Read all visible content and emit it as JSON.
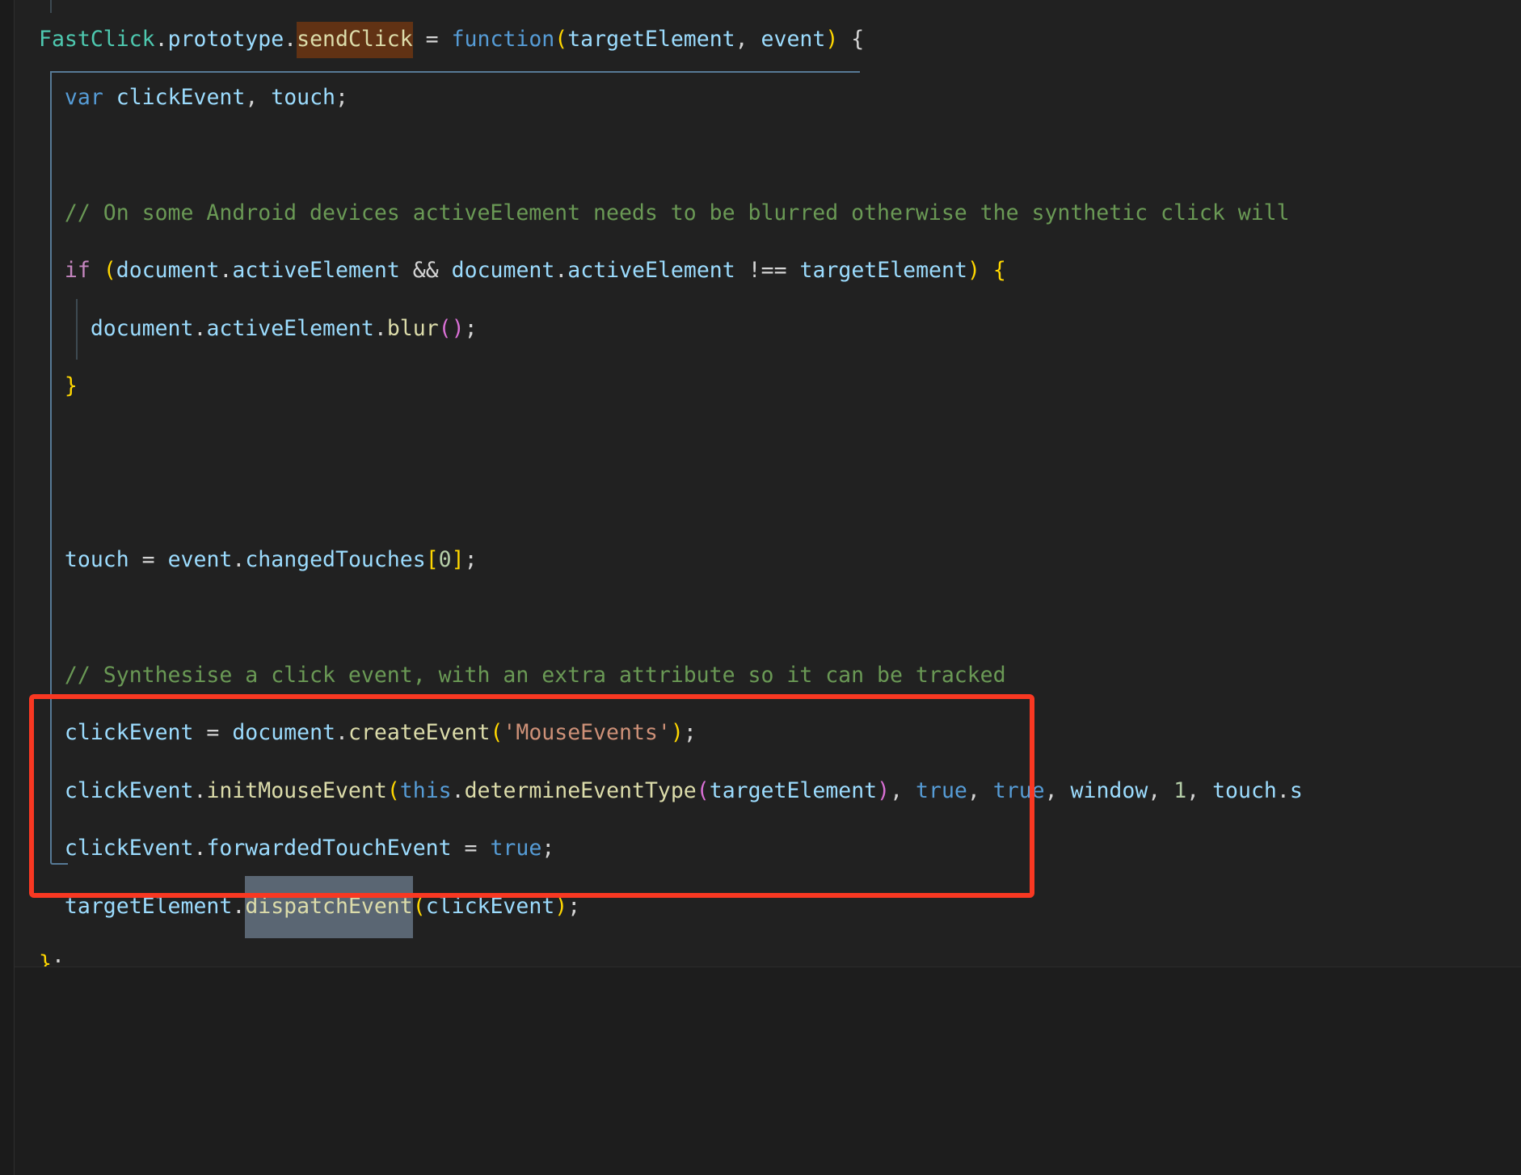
{
  "editor": {
    "language": "javascript",
    "theme": "dark-plus",
    "background_color": "#212121",
    "selection_color": "#5a6673",
    "word_highlight_color": "#613214",
    "annotation_color": "#f93822"
  },
  "annotation": {
    "shape": "rectangle",
    "color": "#f93822",
    "label": "highlighted code region"
  },
  "highlights": {
    "occurrence_highlight": "sendClick",
    "selection": "dispatchEvent"
  },
  "code": {
    "lines": [
      {
        "id": "line-signature",
        "text": "FastClick.prototype.sendClick = function(targetElement, event) {",
        "tokens": [
          {
            "t": "FastClick",
            "c": "t-class"
          },
          {
            "t": ".",
            "c": "t-punct"
          },
          {
            "t": "prototype",
            "c": "t-prop"
          },
          {
            "t": ".",
            "c": "t-punct"
          },
          {
            "t": "sendClick",
            "c": "t-fn",
            "hl": "word"
          },
          {
            "t": " = ",
            "c": "t-punct"
          },
          {
            "t": "function",
            "c": "t-kw"
          },
          {
            "t": "(",
            "c": "t-paren1"
          },
          {
            "t": "targetElement",
            "c": "t-prop"
          },
          {
            "t": ", ",
            "c": "t-punct"
          },
          {
            "t": "event",
            "c": "t-prop"
          },
          {
            "t": ")",
            "c": "t-paren1"
          },
          {
            "t": " ",
            "c": "t-punct"
          },
          {
            "t": "{",
            "c": "t-punct"
          }
        ]
      },
      {
        "id": "line-var",
        "text": "  var clickEvent, touch;",
        "tokens": [
          {
            "t": "  ",
            "c": "t-punct"
          },
          {
            "t": "var",
            "c": "t-kw"
          },
          {
            "t": " ",
            "c": "t-punct"
          },
          {
            "t": "clickEvent",
            "c": "t-prop"
          },
          {
            "t": ", ",
            "c": "t-punct"
          },
          {
            "t": "touch",
            "c": "t-prop"
          },
          {
            "t": ";",
            "c": "t-punct"
          }
        ]
      },
      {
        "id": "line-blank-1",
        "text": "",
        "tokens": []
      },
      {
        "id": "line-comment-android",
        "text": "  // On some Android devices activeElement needs to be blurred otherwise the synthetic click will",
        "tokens": [
          {
            "t": "  ",
            "c": "t-punct"
          },
          {
            "t": "// On some Android devices activeElement needs to be blurred otherwise the synthetic click will",
            "c": "t-cmt"
          }
        ]
      },
      {
        "id": "line-if",
        "text": "  if (document.activeElement && document.activeElement !== targetElement) {",
        "tokens": [
          {
            "t": "  ",
            "c": "t-punct"
          },
          {
            "t": "if",
            "c": "t-ctl"
          },
          {
            "t": " ",
            "c": "t-punct"
          },
          {
            "t": "(",
            "c": "t-paren1"
          },
          {
            "t": "document",
            "c": "t-prop"
          },
          {
            "t": ".",
            "c": "t-punct"
          },
          {
            "t": "activeElement",
            "c": "t-prop"
          },
          {
            "t": " ",
            "c": "t-punct"
          },
          {
            "t": "&&",
            "c": "t-punct"
          },
          {
            "t": " ",
            "c": "t-punct"
          },
          {
            "t": "document",
            "c": "t-prop"
          },
          {
            "t": ".",
            "c": "t-punct"
          },
          {
            "t": "activeElement",
            "c": "t-prop"
          },
          {
            "t": " ",
            "c": "t-punct"
          },
          {
            "t": "!==",
            "c": "t-punct"
          },
          {
            "t": " ",
            "c": "t-punct"
          },
          {
            "t": "targetElement",
            "c": "t-prop"
          },
          {
            "t": ")",
            "c": "t-paren1"
          },
          {
            "t": " ",
            "c": "t-punct"
          },
          {
            "t": "{",
            "c": "t-brace"
          }
        ]
      },
      {
        "id": "line-blur",
        "text": "    document.activeElement.blur();",
        "tokens": [
          {
            "t": "    ",
            "c": "t-punct"
          },
          {
            "t": "document",
            "c": "t-prop"
          },
          {
            "t": ".",
            "c": "t-punct"
          },
          {
            "t": "activeElement",
            "c": "t-prop"
          },
          {
            "t": ".",
            "c": "t-punct"
          },
          {
            "t": "blur",
            "c": "t-fn"
          },
          {
            "t": "(",
            "c": "t-paren2"
          },
          {
            "t": ")",
            "c": "t-paren2"
          },
          {
            "t": ";",
            "c": "t-punct"
          }
        ]
      },
      {
        "id": "line-close-if",
        "text": "  }",
        "tokens": [
          {
            "t": "  ",
            "c": "t-punct"
          },
          {
            "t": "}",
            "c": "t-brace"
          }
        ]
      },
      {
        "id": "line-blank-2",
        "text": "",
        "tokens": []
      },
      {
        "id": "line-blank-3",
        "text": "",
        "tokens": []
      },
      {
        "id": "line-touch",
        "text": "  touch = event.changedTouches[0];",
        "tokens": [
          {
            "t": "  ",
            "c": "t-punct"
          },
          {
            "t": "touch",
            "c": "t-prop"
          },
          {
            "t": " = ",
            "c": "t-punct"
          },
          {
            "t": "event",
            "c": "t-prop"
          },
          {
            "t": ".",
            "c": "t-punct"
          },
          {
            "t": "changedTouches",
            "c": "t-prop"
          },
          {
            "t": "[",
            "c": "t-bracket"
          },
          {
            "t": "0",
            "c": "t-num"
          },
          {
            "t": "]",
            "c": "t-bracket"
          },
          {
            "t": ";",
            "c": "t-punct"
          }
        ]
      },
      {
        "id": "line-blank-4",
        "text": "",
        "tokens": []
      },
      {
        "id": "line-comment-synth",
        "text": "  // Synthesise a click event, with an extra attribute so it can be tracked",
        "tokens": [
          {
            "t": "  ",
            "c": "t-punct"
          },
          {
            "t": "// Synthesise a click event, with an extra attribute so it can be tracked",
            "c": "t-cmt"
          }
        ]
      },
      {
        "id": "line-createevent",
        "text": "  clickEvent = document.createEvent('MouseEvents');",
        "tokens": [
          {
            "t": "  ",
            "c": "t-punct"
          },
          {
            "t": "clickEvent",
            "c": "t-prop"
          },
          {
            "t": " = ",
            "c": "t-punct"
          },
          {
            "t": "document",
            "c": "t-prop"
          },
          {
            "t": ".",
            "c": "t-punct"
          },
          {
            "t": "createEvent",
            "c": "t-fn"
          },
          {
            "t": "(",
            "c": "t-paren1"
          },
          {
            "t": "'MouseEvents'",
            "c": "t-str"
          },
          {
            "t": ")",
            "c": "t-paren1"
          },
          {
            "t": ";",
            "c": "t-punct"
          }
        ]
      },
      {
        "id": "line-initmouseevent",
        "text": "  clickEvent.initMouseEvent(this.determineEventType(targetElement), true, true, window, 1, touch.s",
        "tokens": [
          {
            "t": "  ",
            "c": "t-punct"
          },
          {
            "t": "clickEvent",
            "c": "t-prop"
          },
          {
            "t": ".",
            "c": "t-punct"
          },
          {
            "t": "initMouseEvent",
            "c": "t-fn"
          },
          {
            "t": "(",
            "c": "t-paren1"
          },
          {
            "t": "this",
            "c": "t-kw"
          },
          {
            "t": ".",
            "c": "t-punct"
          },
          {
            "t": "determineEventType",
            "c": "t-fn"
          },
          {
            "t": "(",
            "c": "t-paren2"
          },
          {
            "t": "targetElement",
            "c": "t-prop"
          },
          {
            "t": ")",
            "c": "t-paren2"
          },
          {
            "t": ", ",
            "c": "t-punct"
          },
          {
            "t": "true",
            "c": "t-kw"
          },
          {
            "t": ", ",
            "c": "t-punct"
          },
          {
            "t": "true",
            "c": "t-kw"
          },
          {
            "t": ", ",
            "c": "t-punct"
          },
          {
            "t": "window",
            "c": "t-prop"
          },
          {
            "t": ", ",
            "c": "t-punct"
          },
          {
            "t": "1",
            "c": "t-num"
          },
          {
            "t": ", ",
            "c": "t-punct"
          },
          {
            "t": "touch",
            "c": "t-prop"
          },
          {
            "t": ".",
            "c": "t-punct"
          },
          {
            "t": "s",
            "c": "t-prop"
          }
        ]
      },
      {
        "id": "line-forwardedtouchevent",
        "text": "  clickEvent.forwardedTouchEvent = true;",
        "tokens": [
          {
            "t": "  ",
            "c": "t-punct"
          },
          {
            "t": "clickEvent",
            "c": "t-prop"
          },
          {
            "t": ".",
            "c": "t-punct"
          },
          {
            "t": "forwardedTouchEvent",
            "c": "t-prop"
          },
          {
            "t": " = ",
            "c": "t-punct"
          },
          {
            "t": "true",
            "c": "t-kw"
          },
          {
            "t": ";",
            "c": "t-punct"
          }
        ]
      },
      {
        "id": "line-dispatchevent",
        "text": "  targetElement.dispatchEvent(clickEvent);",
        "tokens": [
          {
            "t": "  ",
            "c": "t-punct"
          },
          {
            "t": "targetElement",
            "c": "t-prop"
          },
          {
            "t": ".",
            "c": "t-punct"
          },
          {
            "t": "dispatchEvent",
            "c": "t-fn",
            "hl": "sel"
          },
          {
            "t": "(",
            "c": "t-paren1"
          },
          {
            "t": "clickEvent",
            "c": "t-prop"
          },
          {
            "t": ")",
            "c": "t-paren1"
          },
          {
            "t": ";",
            "c": "t-punct"
          }
        ]
      },
      {
        "id": "line-close-fn",
        "text": "};",
        "tokens": [
          {
            "t": "}",
            "c": "t-brace"
          },
          {
            "t": ";",
            "c": "t-punct"
          }
        ]
      }
    ]
  }
}
